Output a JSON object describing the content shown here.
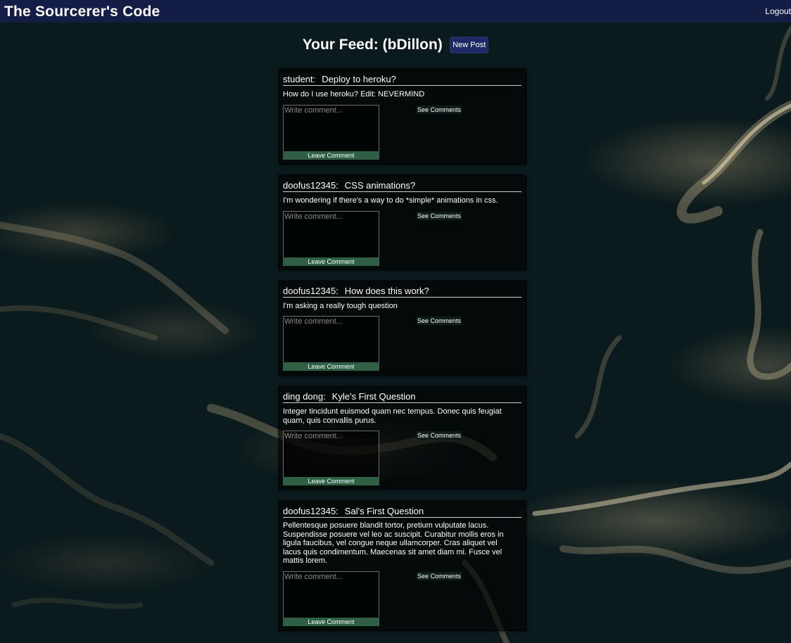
{
  "app": {
    "title": "The Sourcerer's Code",
    "logout_label": "Logout"
  },
  "feed": {
    "title": "Your Feed: (bDillon)",
    "new_post_label": "New Post"
  },
  "comment_form": {
    "placeholder": "Write comment...",
    "leave_label": "Leave Comment",
    "see_label": "See Comments"
  },
  "posts": [
    {
      "author": "student:",
      "title": "Deploy to heroku?",
      "body": "How do I use heroku? Edit: NEVERMIND"
    },
    {
      "author": "doofus12345:",
      "title": "CSS animations?",
      "body": "I'm wondering if there's a way to do *simple* animations in css."
    },
    {
      "author": "doofus12345:",
      "title": "How does this work?",
      "body": "I'm asking a really tough question"
    },
    {
      "author": "ding dong:",
      "title": "Kyle's First Question",
      "body": "Integer tincidunt euismod quam nec tempus. Donec quis feugiat quam, quis convallis purus."
    },
    {
      "author": "doofus12345:",
      "title": "Sal's First Question",
      "body": "Pellentesque posuere blandit tortor, pretium vulputate lacus. Suspendisse posuere vel leo ac suscipit. Curabitur mollis eros in ligula faucibus, vel congue neque ullamcorper. Cras aliquet vel lacus quis condimentum. Maecenas sit amet diam mi. Fusce vel mattis lorem."
    }
  ]
}
